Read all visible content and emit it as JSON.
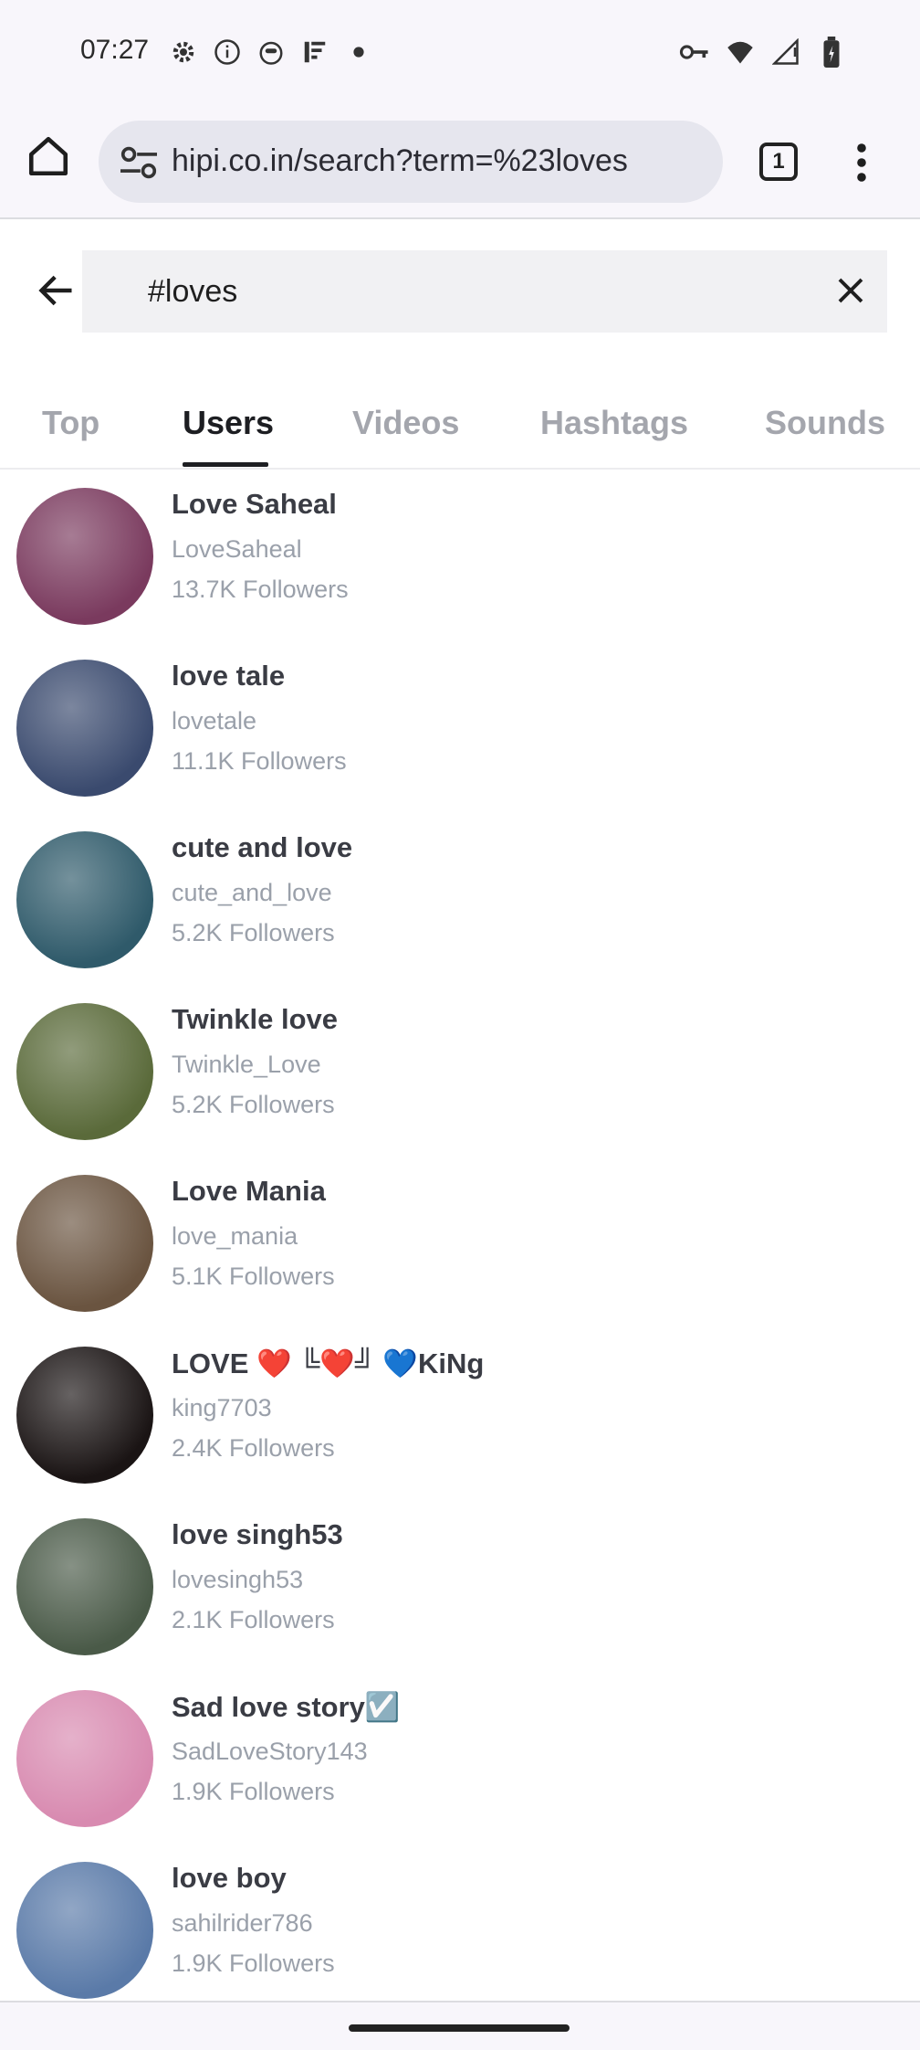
{
  "status_bar": {
    "time": "07:27",
    "left_icons": [
      "gear-icon",
      "info-icon",
      "cat-face-icon",
      "wifi-signal-icon",
      "dot-icon"
    ],
    "right_icons": [
      "key-icon",
      "wifi-icon",
      "signal-icon",
      "battery-icon"
    ]
  },
  "browser": {
    "url": "hipi.co.in/search?term=%23loves",
    "tab_count": "1"
  },
  "search": {
    "query": "#loves"
  },
  "tabs": [
    {
      "label": "Top"
    },
    {
      "label": "Users"
    },
    {
      "label": "Videos"
    },
    {
      "label": "Hashtags"
    },
    {
      "label": "Sounds"
    }
  ],
  "active_tab": "Users",
  "users": [
    {
      "name": "Love Saheal",
      "handle": "LoveSaheal",
      "followers": "13.7K Followers",
      "avatar_color": "#7a3a5e"
    },
    {
      "name": "love tale",
      "handle": "lovetale",
      "followers": "11.1K Followers",
      "avatar_color": "#3a4a6e"
    },
    {
      "name": "cute and love",
      "handle": "cute_and_love",
      "followers": "5.2K Followers",
      "avatar_color": "#2f5a6a"
    },
    {
      "name": "Twinkle love",
      "handle": "Twinkle_Love",
      "followers": "5.2K Followers",
      "avatar_color": "#5a6a3a"
    },
    {
      "name": "Love Mania",
      "handle": "love_mania",
      "followers": "5.1K Followers",
      "avatar_color": "#6a5440"
    },
    {
      "name": "LOVE ❤️ ╚❤️╝ 💙KiNg",
      "handle": "king7703",
      "followers": "2.4K Followers",
      "avatar_color": "#1a1414"
    },
    {
      "name": "love singh53",
      "handle": "lovesingh53",
      "followers": "2.1K Followers",
      "avatar_color": "#4a5a48"
    },
    {
      "name": "Sad love story☑️",
      "handle": "SadLoveStory143",
      "followers": "1.9K Followers",
      "avatar_color": "#d88ab0"
    },
    {
      "name": "love boy",
      "handle": "sahilrider786",
      "followers": "1.9K Followers",
      "avatar_color": "#5a7aa8"
    }
  ]
}
